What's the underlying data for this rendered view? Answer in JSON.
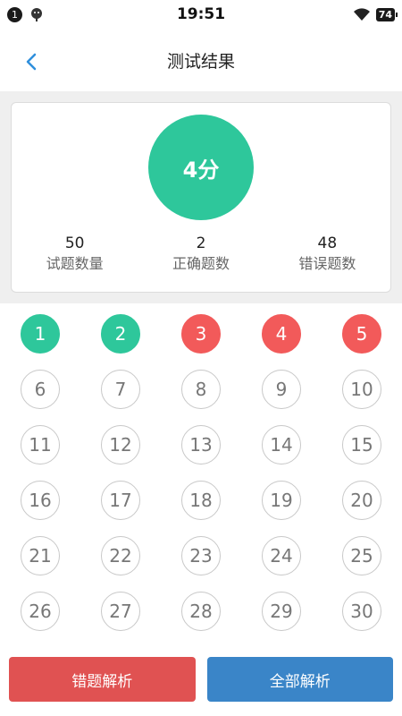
{
  "status_bar": {
    "notification_count": "1",
    "time": "19:51",
    "battery": "74"
  },
  "nav": {
    "title": "测试结果"
  },
  "result": {
    "score": "4分",
    "score_color": "#2ec79b",
    "stats": [
      {
        "value": "50",
        "label": "试题数量"
      },
      {
        "value": "2",
        "label": "正确题数"
      },
      {
        "value": "48",
        "label": "错误题数"
      }
    ]
  },
  "questions": [
    {
      "num": "1",
      "state": "correct"
    },
    {
      "num": "2",
      "state": "correct"
    },
    {
      "num": "3",
      "state": "wrong"
    },
    {
      "num": "4",
      "state": "wrong"
    },
    {
      "num": "5",
      "state": "wrong"
    },
    {
      "num": "6",
      "state": "unanswered"
    },
    {
      "num": "7",
      "state": "unanswered"
    },
    {
      "num": "8",
      "state": "unanswered"
    },
    {
      "num": "9",
      "state": "unanswered"
    },
    {
      "num": "10",
      "state": "unanswered"
    },
    {
      "num": "11",
      "state": "unanswered"
    },
    {
      "num": "12",
      "state": "unanswered"
    },
    {
      "num": "13",
      "state": "unanswered"
    },
    {
      "num": "14",
      "state": "unanswered"
    },
    {
      "num": "15",
      "state": "unanswered"
    },
    {
      "num": "16",
      "state": "unanswered"
    },
    {
      "num": "17",
      "state": "unanswered"
    },
    {
      "num": "18",
      "state": "unanswered"
    },
    {
      "num": "19",
      "state": "unanswered"
    },
    {
      "num": "20",
      "state": "unanswered"
    },
    {
      "num": "21",
      "state": "unanswered"
    },
    {
      "num": "22",
      "state": "unanswered"
    },
    {
      "num": "23",
      "state": "unanswered"
    },
    {
      "num": "24",
      "state": "unanswered"
    },
    {
      "num": "25",
      "state": "unanswered"
    },
    {
      "num": "26",
      "state": "unanswered"
    },
    {
      "num": "27",
      "state": "unanswered"
    },
    {
      "num": "28",
      "state": "unanswered"
    },
    {
      "num": "29",
      "state": "unanswered"
    },
    {
      "num": "30",
      "state": "unanswered"
    }
  ],
  "buttons": {
    "wrong_analysis": "错题解析",
    "all_analysis": "全部解析"
  },
  "colors": {
    "correct": "#2ec79b",
    "wrong": "#f25a5a",
    "accent_blue": "#3a85c8"
  }
}
